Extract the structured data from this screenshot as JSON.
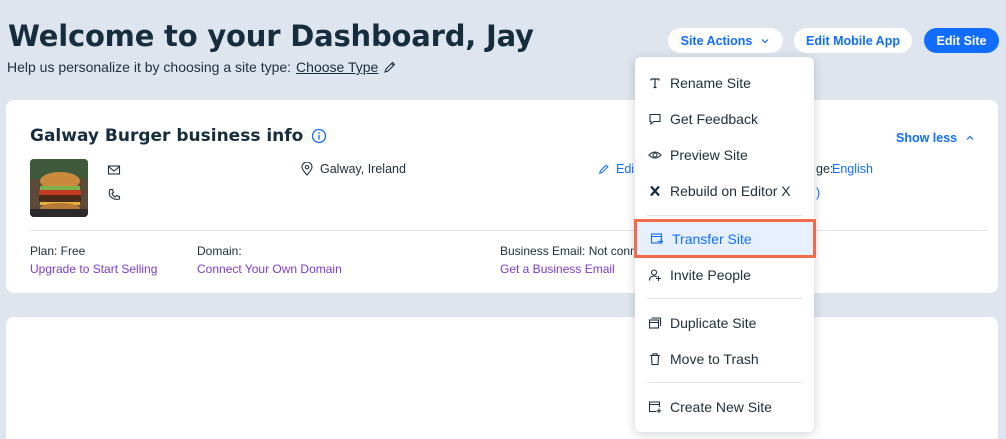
{
  "header": {
    "title": "Welcome to your Dashboard, Jay",
    "subtitle_prefix": "Help us personalize it by choosing a site type:",
    "choose_type": "Choose Type"
  },
  "actions": {
    "site_actions": "Site Actions",
    "edit_mobile_app": "Edit Mobile App",
    "edit_site": "Edit Site"
  },
  "business": {
    "title": "Galway Burger business info",
    "show_less": "Show less",
    "location": "Galway, Ireland",
    "edit": "Edi",
    "language_label": "ge:",
    "language": "English",
    "paren": ")",
    "plan_label": "Plan: Free",
    "plan_link": "Upgrade to Start Selling",
    "domain_label": "Domain:",
    "domain_link": "Connect Your Own Domain",
    "email_label": "Business Email: Not conn",
    "email_link": "Get a Business Email"
  },
  "menu": {
    "items": [
      {
        "label": "Rename Site",
        "icon": "text-icon"
      },
      {
        "label": "Get Feedback",
        "icon": "chat-icon"
      },
      {
        "label": "Preview Site",
        "icon": "eye-icon"
      },
      {
        "label": "Rebuild on Editor X",
        "icon": "editor-x-icon"
      },
      {
        "label": "Transfer Site",
        "icon": "transfer-icon",
        "highlighted": true
      },
      {
        "label": "Invite People",
        "icon": "invite-icon"
      },
      {
        "label": "Duplicate Site",
        "icon": "duplicate-icon"
      },
      {
        "label": "Move to Trash",
        "icon": "trash-icon"
      },
      {
        "label": "Create New Site",
        "icon": "new-site-icon"
      }
    ]
  },
  "colors": {
    "accent": "#116dff",
    "highlight_border": "#f26b4b",
    "link_purple": "#7c3ccc",
    "background": "#dfe5ee"
  }
}
